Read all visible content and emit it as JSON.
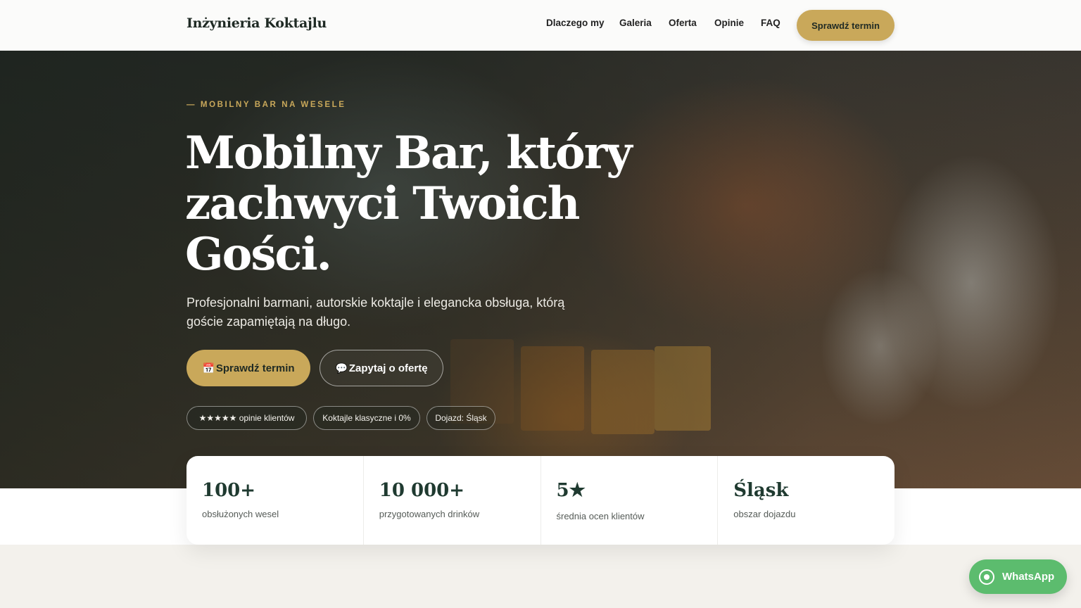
{
  "header": {
    "logo": "Inżynieria Koktajlu",
    "nav": [
      "Dlaczego my",
      "Galeria",
      "Oferta",
      "Opinie",
      "FAQ"
    ],
    "cta": "Sprawdź termin"
  },
  "hero": {
    "eyebrow": "— MOBILNY BAR NA WESELE",
    "title_lines": [
      "Mobilny Bar, który",
      "zachwyci Twoich",
      "Gości."
    ],
    "subtitle": "Profesjonalni barmani, autorskie koktajle i elegancka obsługa, którą goście zapamiętają na długo.",
    "primary_icon": "📅",
    "primary_button": "Sprawdź termin",
    "secondary_icon": "💬",
    "secondary_button": "Zapytaj o ofertę",
    "chips": [
      "★★★★★ opinie klientów",
      "Koktajle klasyczne i 0%",
      "Dojazd: Śląsk"
    ]
  },
  "stats": [
    {
      "value": "100+",
      "label": "obsłużonych wesel"
    },
    {
      "value": "10 000+",
      "label": "przygotowanych drinków"
    },
    {
      "value": "5★",
      "label": "średnia ocen klientów"
    },
    {
      "value": "Śląsk",
      "label": "obszar dojazdu"
    }
  ],
  "whatsapp": {
    "label": "WhatsApp",
    "icon": "whatsapp-icon"
  },
  "colors": {
    "accent": "#c9a85a",
    "dark": "#1f3a30",
    "whatsapp": "#5cbc6e"
  }
}
